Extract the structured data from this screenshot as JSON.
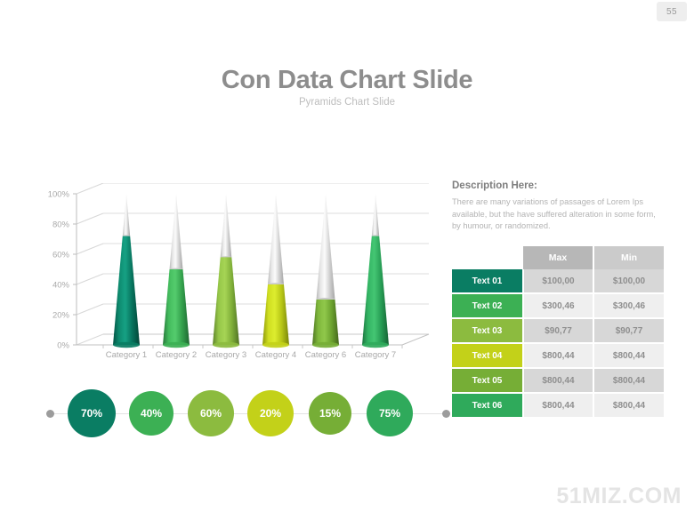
{
  "page": {
    "number": "55",
    "watermark": "51MIZ.COM"
  },
  "header": {
    "title": "Con Data Chart Slide",
    "subtitle": "Pyramids Chart Slide"
  },
  "description": {
    "heading": "Description Here:",
    "body": "There are many  variations of passages   of Lorem Ips available, but the have suffered  alteration in some form, by humour,  or randomized."
  },
  "table": {
    "headers": [
      "",
      "Max",
      "Min"
    ],
    "rows": [
      {
        "label": "Text 01",
        "max": "$100,00",
        "min": "$100,00",
        "color": "#0a7d63"
      },
      {
        "label": "Text 02",
        "max": "$300,46",
        "min": "$300,46",
        "color": "#3cb054"
      },
      {
        "label": "Text 03",
        "max": "$90,77",
        "min": "$90,77",
        "color": "#8cbb3f"
      },
      {
        "label": "Text 04",
        "max": "$800,44",
        "min": "$800,44",
        "color": "#c3d119"
      },
      {
        "label": "Text 05",
        "max": "$800,44",
        "min": "$800,44",
        "color": "#76ae36"
      },
      {
        "label": "Text 06",
        "max": "$800,44",
        "min": "$800,44",
        "color": "#2faa5b"
      }
    ]
  },
  "circles": [
    {
      "label": "70%",
      "value": 70,
      "color": "#0a7d63"
    },
    {
      "label": "40%",
      "value": 40,
      "color": "#3cb054"
    },
    {
      "label": "60%",
      "value": 60,
      "color": "#8cbb3f"
    },
    {
      "label": "20%",
      "value": 20,
      "color": "#c3d119"
    },
    {
      "label": "15%",
      "value": 15,
      "color": "#76ae36"
    },
    {
      "label": "75%",
      "value": 75,
      "color": "#2faa5b"
    }
  ],
  "chart_data": {
    "type": "bar",
    "title": "Con Data Chart Slide",
    "subtitle": "Pyramids Chart Slide",
    "xlabel": "",
    "ylabel": "",
    "ylim": [
      0,
      100
    ],
    "yticks": [
      "0%",
      "20%",
      "40%",
      "60%",
      "80%",
      "100%"
    ],
    "grid": true,
    "legend": "none",
    "style": "3d-cone",
    "categories": [
      "Category 1",
      "Category 2",
      "Category 3",
      "Category 4",
      "Category 6",
      "Category 7"
    ],
    "series": [
      {
        "name": "Filled",
        "values": [
          72,
          50,
          58,
          40,
          30,
          72
        ],
        "colors": [
          "#0a7d63",
          "#3cb054",
          "#8cbb3f",
          "#c3d119",
          "#76ae36",
          "#2faa5b"
        ]
      },
      {
        "name": "Remainder",
        "values": [
          28,
          50,
          42,
          60,
          70,
          28
        ],
        "color": "#d2d2d2"
      }
    ]
  }
}
